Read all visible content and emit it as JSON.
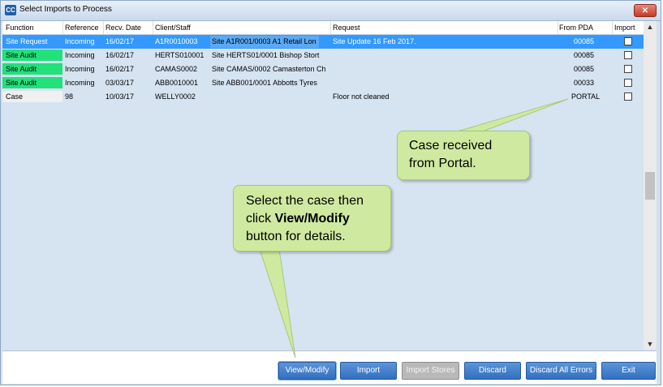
{
  "window": {
    "app_icon_text": "CC",
    "title": "Select Imports to Process",
    "close_glyph": "✕"
  },
  "columns": [
    "Function",
    "Reference",
    "Recv. Date",
    "Client/Staff",
    "Request",
    "From PDA",
    "Import"
  ],
  "rows": [
    {
      "function": "Site Request",
      "reference": "Incoming",
      "recv_date": "16/02/17",
      "client": "A1R0010003",
      "staff": "Site A1R001/0003 A1 Retail Lon",
      "request": "Site Update 16 Feb 2017.",
      "from_pda": "00085",
      "import": false,
      "selected": true
    },
    {
      "function": "Site Audit",
      "reference": "Incoming",
      "recv_date": "16/02/17",
      "client": "HERTS010001",
      "staff": "Site HERTS01/0001 Bishop Stort",
      "request": "",
      "from_pda": "00085",
      "import": false
    },
    {
      "function": "Site Audit",
      "reference": "Incoming",
      "recv_date": "16/02/17",
      "client": "CAMAS0002",
      "staff": "Site CAMAS/0002 Camasterton Ch",
      "request": "",
      "from_pda": "00085",
      "import": false
    },
    {
      "function": "Site Audit",
      "reference": "Incoming",
      "recv_date": "03/03/17",
      "client": "ABB0010001",
      "staff": "Site ABB001/0001 Abbotts Tyres",
      "request": "",
      "from_pda": "00033",
      "import": false
    },
    {
      "function": "Case",
      "reference": "98",
      "recv_date": "10/03/17",
      "client": "WELLY0002",
      "staff": "",
      "request": "Floor not cleaned",
      "from_pda": "PORTAL",
      "import": false
    }
  ],
  "scrollbar": {
    "up": "▲",
    "down": "▼"
  },
  "buttons": {
    "view_modify": "View/Modify",
    "import": "Import",
    "import_stores": "Import Stores",
    "discard": "Discard",
    "discard_all_errors": "Discard All Errors",
    "exit": "Exit"
  },
  "callouts": {
    "portal": [
      "Case received",
      "from Portal."
    ],
    "select_line1": "Select the case then",
    "select_line2_pre": "click ",
    "select_line2_bold": "View/Modify",
    "select_line3": "button for details."
  },
  "colors": {
    "selected_row": "#3399ff",
    "site_audit_badge": "#22e07a",
    "button": "#3270c0",
    "callout": "#cfeaa0"
  }
}
